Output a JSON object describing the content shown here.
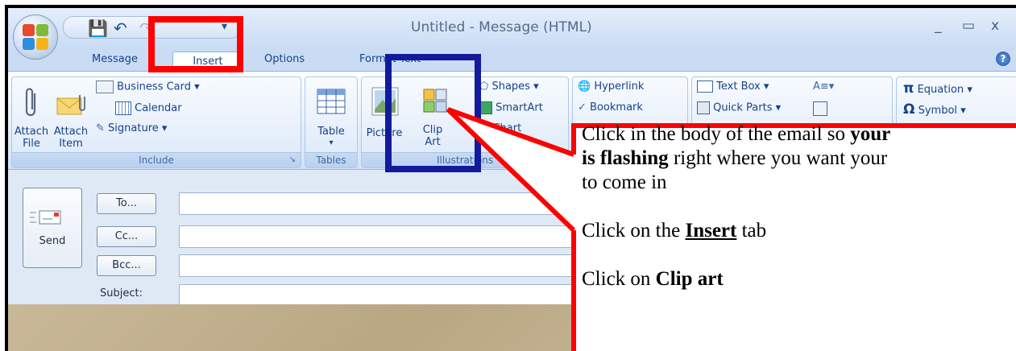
{
  "window": {
    "title": "Untitled - Message (HTML)",
    "controls": {
      "minimize": "_",
      "maximize": "▭",
      "close": "x"
    }
  },
  "quick_access": {
    "icons": [
      "save-icon",
      "undo-icon",
      "redo-icon"
    ]
  },
  "tabs": [
    {
      "label": "Message",
      "active": false
    },
    {
      "label": "Insert",
      "active": true
    },
    {
      "label": "Options",
      "active": false
    },
    {
      "label": "Format Text",
      "active": false
    }
  ],
  "ribbon": {
    "include": {
      "label": "Include",
      "attach_file": [
        "Attach",
        "File"
      ],
      "attach_item": [
        "Attach",
        "Item"
      ],
      "business_card": "Business Card",
      "calendar": "Calendar",
      "signature": "Signature"
    },
    "tables": {
      "label": "Tables",
      "table": "Table"
    },
    "illustrations": {
      "label": "Illustrations",
      "picture": "Picture",
      "clip_art": [
        "Clip",
        "Art"
      ],
      "shapes": "Shapes",
      "smartart": "SmartArt",
      "chart": "Chart"
    },
    "links": {
      "hyperlink": "Hyperlink",
      "bookmark": "Bookmark"
    },
    "text": {
      "text_box": "Text Box",
      "quick_parts": "Quick Parts"
    },
    "symbols": {
      "equation": "Equation",
      "symbol": "Symbol"
    }
  },
  "compose": {
    "send": "Send",
    "to": "To...",
    "cc": "Cc...",
    "bcc": "Bcc...",
    "subject": "Subject:"
  },
  "callout": {
    "line1_pre": "Click in the body of the email so ",
    "line1_bold": "your",
    "line2_bold": "is flashing",
    "line2_rest": " right where you want your",
    "line3": "to come in",
    "step2_pre": "Click on the ",
    "step2_bold": "Insert",
    "step2_post": " tab",
    "step3_pre": "Click on ",
    "step3_bold": "Clip art"
  },
  "colors": {
    "highlight_red": "#ff0000",
    "highlight_blue": "#131a9b",
    "ribbon_text": "#15428b"
  }
}
